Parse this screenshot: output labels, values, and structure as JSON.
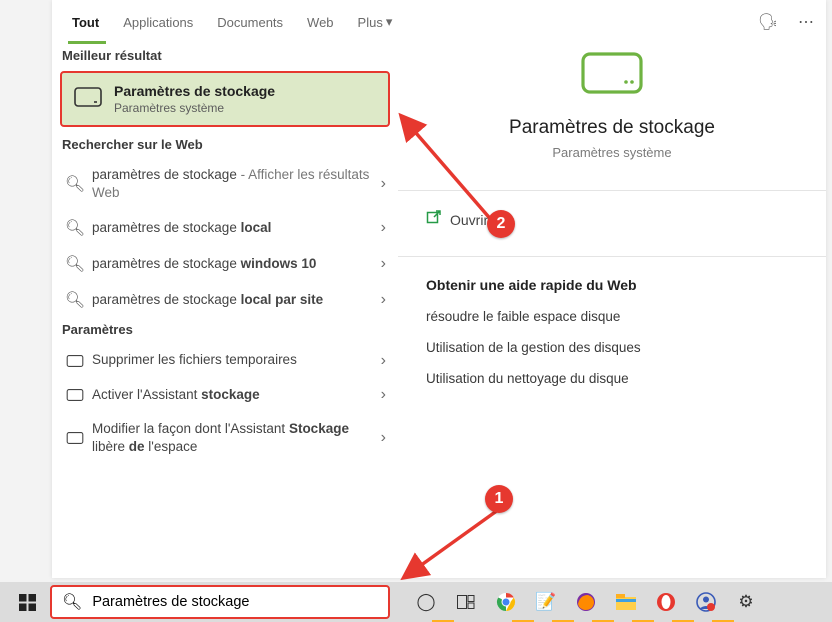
{
  "tabs": {
    "active": "Tout",
    "items": [
      "Tout",
      "Applications",
      "Documents",
      "Web",
      "Plus"
    ]
  },
  "sections": {
    "best": "Meilleur résultat",
    "web": "Rechercher sur le Web",
    "settings": "Paramètres"
  },
  "best_result": {
    "title": "Paramètres de stockage",
    "subtitle": "Paramètres système"
  },
  "web_results": [
    {
      "label": "paramètres de stockage",
      "suffix": " - Afficher les résultats Web"
    },
    {
      "label_pre": "paramètres de stockage ",
      "label_bold": "local"
    },
    {
      "label_pre": "paramètres de stockage ",
      "label_bold": "windows 10"
    },
    {
      "label_pre": "paramètres de stockage ",
      "label_bold": "local par site"
    }
  ],
  "settings_results": [
    {
      "label": "Supprimer les fichiers temporaires"
    },
    {
      "label_pre": "Activer l'Assistant ",
      "label_bold": "stockage"
    },
    {
      "label_html": "Modifier la façon dont l'Assistant <b>Stockage</b> libère <b>de</b> l'espace"
    }
  ],
  "preview": {
    "title": "Paramètres de stockage",
    "subtitle": "Paramètres système",
    "open": "Ouvrir"
  },
  "help": {
    "title": "Obtenir une aide rapide du Web",
    "items": [
      "résoudre le faible espace disque",
      "Utilisation de la gestion des disques",
      "Utilisation du nettoyage du disque"
    ]
  },
  "search_value": "Paramètres de stockage",
  "annotations": {
    "badge1": "1",
    "badge2": "2"
  }
}
